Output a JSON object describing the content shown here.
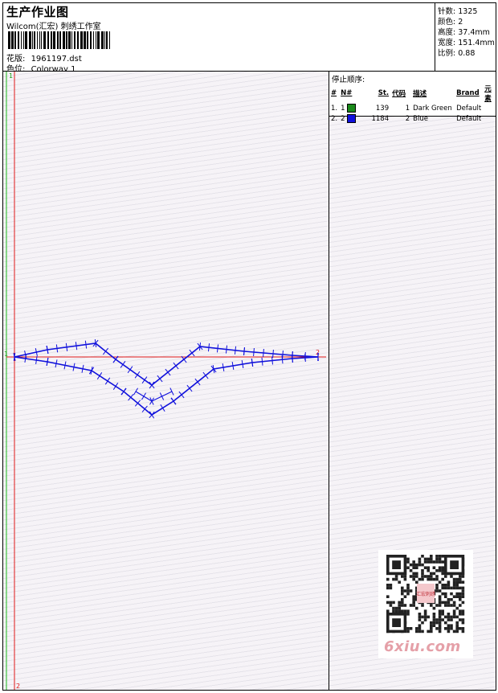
{
  "header": {
    "title": "生产作业图",
    "company": "Wilcom(汇宏) 刺绣工作室",
    "design_label": "花版:",
    "design_value": "1961197.dst",
    "colorway_label": "色位:",
    "colorway_value": "Colorway 1"
  },
  "stats": [
    {
      "label": "针数:",
      "value": "1325"
    },
    {
      "label": "颜色:",
      "value": "2"
    },
    {
      "label": "高度:",
      "value": "37.4mm"
    },
    {
      "label": "宽度:",
      "value": "151.4mm"
    },
    {
      "label": "比例:",
      "value": "0.88"
    }
  ],
  "stop_sequence": {
    "title": "停止顺序:",
    "columns": [
      "#",
      "N#",
      "St.",
      "代码",
      "描述",
      "Brand",
      "元素"
    ],
    "rows": [
      {
        "num": "1.",
        "needle": "1",
        "color": "#1a8a1a",
        "stitches": "139",
        "code": "1",
        "description": "Dark Green",
        "brand": "Default"
      },
      {
        "num": "2.",
        "needle": "2",
        "color": "#1010dd",
        "stitches": "1184",
        "code": "2",
        "description": "Blue",
        "brand": "Default"
      }
    ]
  },
  "markers": {
    "top": "1",
    "bottom": "2",
    "start": "1",
    "end": "2"
  },
  "watermark": "6xiu.com",
  "qr_center_text": "汇宏刺绣"
}
